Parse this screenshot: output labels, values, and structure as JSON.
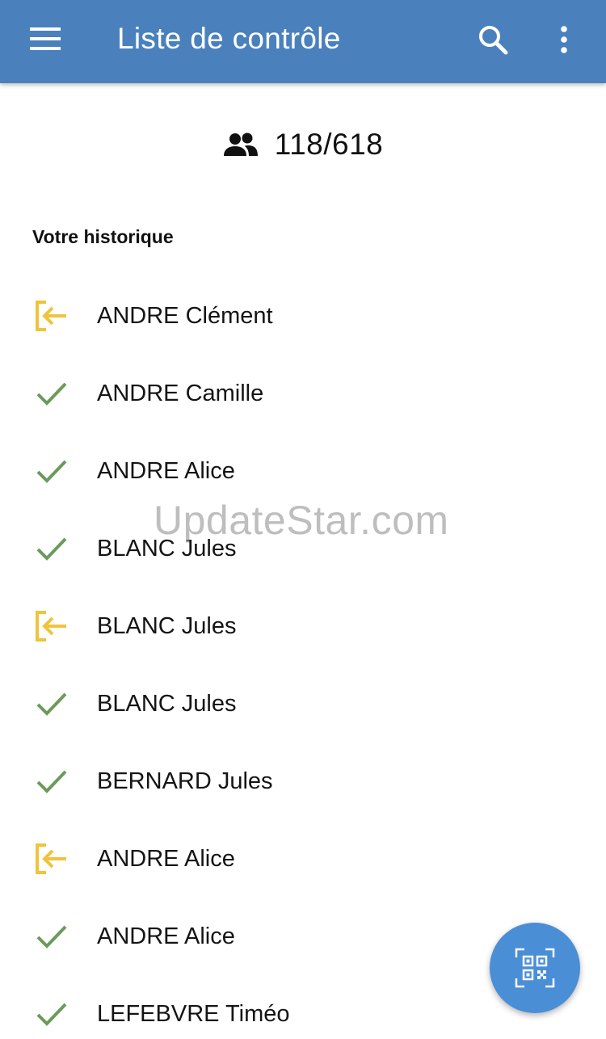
{
  "appbar": {
    "title": "Liste de contrôle",
    "menu_icon": "hamburger-menu-icon",
    "search_icon": "search-icon",
    "more_icon": "more-vert-icon",
    "background": "#4a81bd"
  },
  "counter": {
    "icon": "people-icon",
    "value": "118/618"
  },
  "history": {
    "title": "Votre historique",
    "items": [
      {
        "name": "ANDRE Clément",
        "status": "exit"
      },
      {
        "name": "ANDRE Camille",
        "status": "checked"
      },
      {
        "name": "ANDRE Alice",
        "status": "checked"
      },
      {
        "name": "BLANC Jules",
        "status": "checked"
      },
      {
        "name": "BLANC Jules",
        "status": "exit"
      },
      {
        "name": "BLANC Jules",
        "status": "checked"
      },
      {
        "name": "BERNARD Jules",
        "status": "checked"
      },
      {
        "name": "ANDRE Alice",
        "status": "exit"
      },
      {
        "name": "ANDRE Alice",
        "status": "checked"
      },
      {
        "name": "LEFEBVRE Timéo",
        "status": "checked"
      }
    ]
  },
  "fab": {
    "icon": "qr-code-scan-icon",
    "color": "#4a8ed6"
  },
  "watermark": "UpdateStar.com",
  "colors": {
    "exit": "#f0c33c",
    "checked": "#6b9a5a"
  }
}
